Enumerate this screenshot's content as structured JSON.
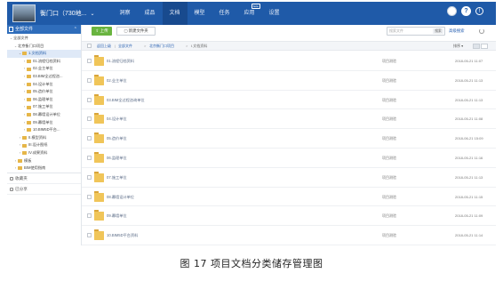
{
  "header": {
    "project_title": "衡门口（730地...",
    "nav": [
      {
        "label": "洞察",
        "active": false,
        "badge": ""
      },
      {
        "label": "成品",
        "active": false,
        "badge": ""
      },
      {
        "label": "文档",
        "active": true,
        "badge": ""
      },
      {
        "label": "模型",
        "active": false,
        "badge": ""
      },
      {
        "label": "任务",
        "active": false,
        "badge": ""
      },
      {
        "label": "应用",
        "active": false,
        "badge": "beta"
      },
      {
        "label": "设置",
        "active": false,
        "badge": ""
      }
    ],
    "help_label": "?",
    "info_label": "!"
  },
  "sidebar": {
    "header_label": "全部文件",
    "tree": [
      {
        "label": "全部文件",
        "level": 0,
        "arrow": "v",
        "folder": false,
        "selected": false
      },
      {
        "label": "北京衡门口项目",
        "level": 1,
        "arrow": "v",
        "folder": false,
        "selected": false
      },
      {
        "label": "1.文档资料",
        "level": 2,
        "arrow": "v",
        "folder": true,
        "selected": true
      },
      {
        "label": "01.流程归档资料",
        "level": 3,
        "arrow": ">",
        "folder": true,
        "selected": false
      },
      {
        "label": "02.业主单位",
        "level": 3,
        "arrow": ">",
        "folder": true,
        "selected": false
      },
      {
        "label": "03.BIM全过程咨...",
        "level": 3,
        "arrow": ">",
        "folder": true,
        "selected": false
      },
      {
        "label": "04.设计单位",
        "level": 3,
        "arrow": ">",
        "folder": true,
        "selected": false
      },
      {
        "label": "05.造价单位",
        "level": 3,
        "arrow": ">",
        "folder": true,
        "selected": false
      },
      {
        "label": "06.监理单位",
        "level": 3,
        "arrow": ">",
        "folder": true,
        "selected": false
      },
      {
        "label": "07.施工单位",
        "level": 3,
        "arrow": ">",
        "folder": true,
        "selected": false
      },
      {
        "label": "08.幕墙设计单位",
        "level": 3,
        "arrow": ">",
        "folder": true,
        "selected": false
      },
      {
        "label": "09.幕墙单位",
        "level": 3,
        "arrow": ">",
        "folder": true,
        "selected": false
      },
      {
        "label": "10.BIM5D平台...",
        "level": 3,
        "arrow": ">",
        "folder": true,
        "selected": false
      },
      {
        "label": "II.模型资料",
        "level": 2,
        "arrow": ">",
        "folder": true,
        "selected": false
      },
      {
        "label": "III.设计图纸",
        "level": 2,
        "arrow": ">",
        "folder": true,
        "selected": false
      },
      {
        "label": "IV.成果资料",
        "level": 2,
        "arrow": ">",
        "folder": true,
        "selected": false
      },
      {
        "label": "模板",
        "level": 1,
        "arrow": ">",
        "folder": true,
        "selected": false
      },
      {
        "label": "BIM使用指南",
        "level": 1,
        "arrow": ">",
        "folder": true,
        "selected": false
      }
    ],
    "favorites_label": "收藏夹",
    "shared_label": "已分享"
  },
  "toolbar": {
    "upload_label": "上传",
    "new_folder_label": "新建文件夹",
    "search_placeholder": "搜索文件",
    "search_button": "搜索",
    "advanced_search": "高级搜索"
  },
  "breadcrumb": {
    "items": [
      "返回上级",
      "全部文件",
      "北京衡门口项目",
      "I.文档资料"
    ],
    "sort_label": "排序"
  },
  "files": [
    {
      "name": "01.流程归档资料",
      "owner": "项目测验",
      "date": "2018-05-21 11:07"
    },
    {
      "name": "02.业主单位",
      "owner": "项目测验",
      "date": "2018-05-21 11:13"
    },
    {
      "name": "03.BIM全过程咨询单位",
      "owner": "项目测验",
      "date": "2018-05-21 11:13"
    },
    {
      "name": "04.设计单位",
      "owner": "项目测验",
      "date": "2018-05-21 11:08"
    },
    {
      "name": "05.造价单位",
      "owner": "项目测验",
      "date": "2018-06-21 15:09"
    },
    {
      "name": "06.监理单位",
      "owner": "项目测验",
      "date": "2018-05-21 11:16"
    },
    {
      "name": "07.施工单位",
      "owner": "项目测验",
      "date": "2018-05-21 11:13"
    },
    {
      "name": "08.幕墙设计单位",
      "owner": "项目测验",
      "date": "2018-05-21 11:15"
    },
    {
      "name": "09.幕墙单位",
      "owner": "项目测验",
      "date": "2018-05-21 11:09"
    },
    {
      "name": "10.BIM5D平台资料",
      "owner": "项目测验",
      "date": "2018-05-21 11:14"
    }
  ],
  "caption": "图 17  项目文档分类储存管理图",
  "colors": {
    "brand": "#1f5aa8",
    "upload": "#69b43f",
    "folder": "#f0c559"
  }
}
